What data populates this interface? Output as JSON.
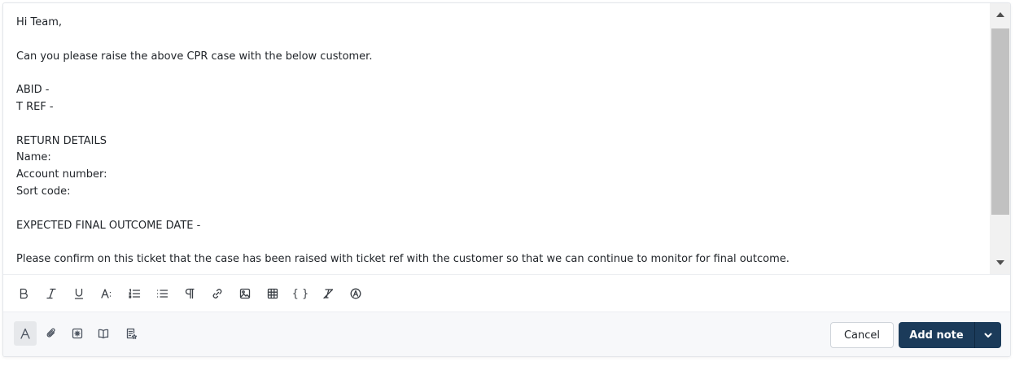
{
  "editor": {
    "lines": [
      "Hi Team,",
      "",
      "Can you please raise the above CPR case with the below customer.",
      "",
      "ABID -",
      "T REF -",
      "",
      "RETURN DETAILS",
      "Name:",
      "Account number:",
      "Sort code:",
      "",
      "EXPECTED FINAL OUTCOME DATE -",
      "",
      "Please confirm on this ticket that the case has been raised with ticket ref with the customer so that we can continue to monitor for final outcome."
    ]
  },
  "format_toolbar": {
    "icons": [
      "bold-icon",
      "italic-icon",
      "underline-icon",
      "font-size-icon",
      "numbered-list-icon",
      "bulleted-list-icon",
      "paragraph-icon",
      "link-icon",
      "image-icon",
      "table-icon",
      "code-block-icon",
      "clear-formatting-icon",
      "ai-assist-icon"
    ],
    "code_glyph": "{ }"
  },
  "footer": {
    "left_icons": [
      "text-format-icon",
      "attachment-icon",
      "canned-response-icon",
      "knowledge-base-icon",
      "template-icon"
    ],
    "cancel_label": "Cancel",
    "add_note_label": "Add note"
  },
  "colors": {
    "primary_button": "#1b3b5a",
    "footer_bg": "#f7f8fa",
    "scrollbar_thumb": "#c1c1c1"
  }
}
